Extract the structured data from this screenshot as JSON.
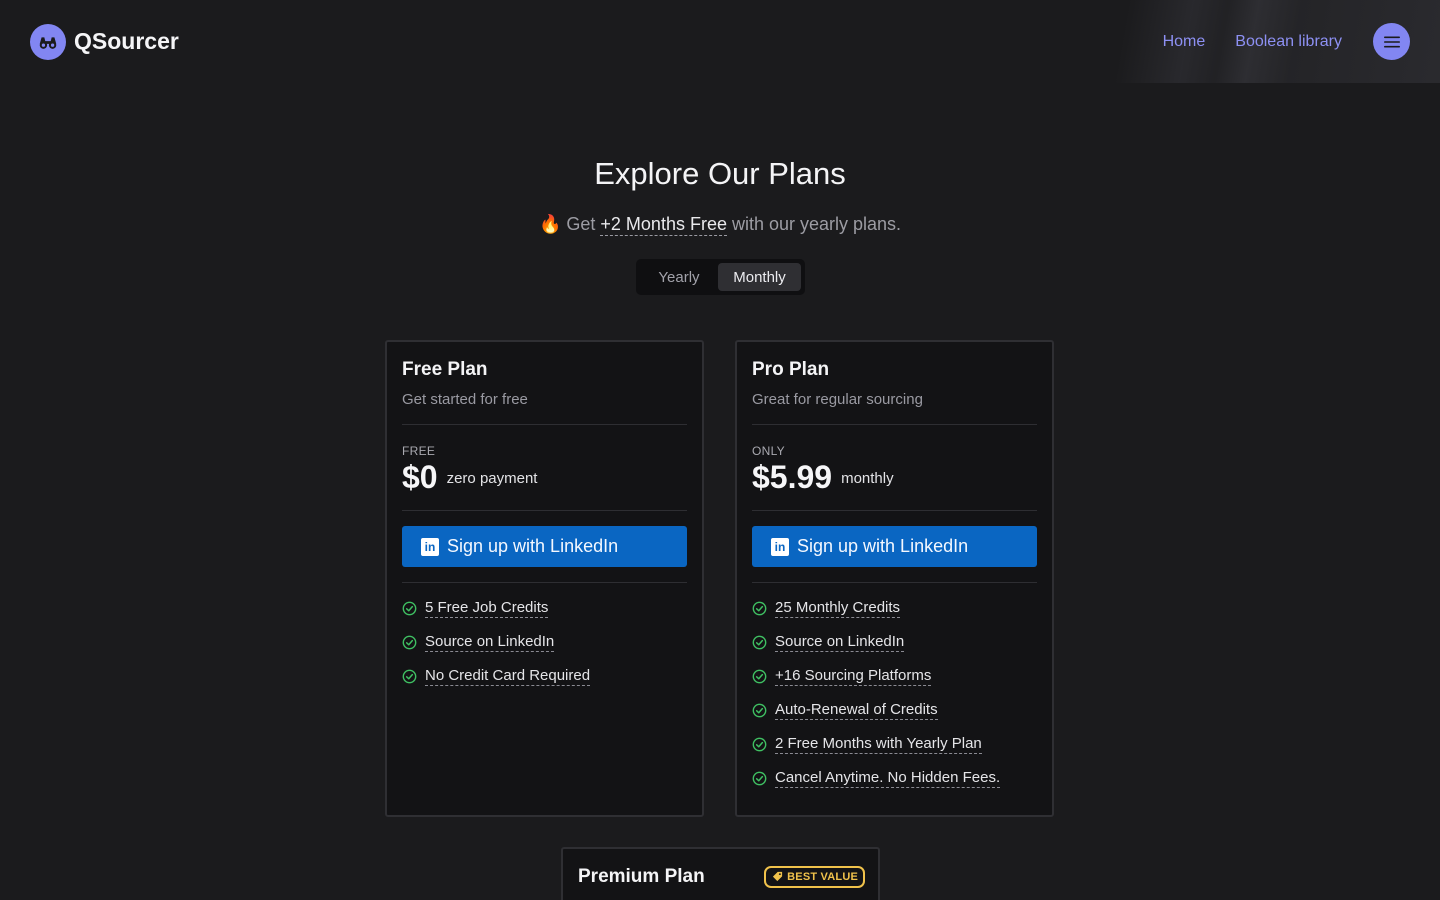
{
  "brand": {
    "name": "QSourcer",
    "logo_icon": "binoculars-icon",
    "accent": "#8286f2"
  },
  "nav": {
    "items": [
      {
        "label": "Home"
      },
      {
        "label": "Boolean library"
      }
    ],
    "menu_icon": "hamburger-menu-icon"
  },
  "hero": {
    "title": "Explore Our Plans",
    "sub_emoji": "🔥",
    "sub_prefix": "Get",
    "sub_highlight": "+2 Months Free",
    "sub_suffix": "with our yearly plans."
  },
  "billing_toggle": {
    "options": [
      {
        "label": "Yearly",
        "selected": false
      },
      {
        "label": "Monthly",
        "selected": true
      }
    ]
  },
  "plans": [
    {
      "name": "Free Plan",
      "description": "Get started for free",
      "price_label": "FREE",
      "price": "$0",
      "price_note": "zero payment",
      "cta_label": "Sign up with LinkedIn",
      "cta_color": "#0a66c2",
      "features": [
        "5 Free Job Credits",
        "Source on LinkedIn",
        "No Credit Card Required"
      ]
    },
    {
      "name": "Pro Plan",
      "description": "Great for regular sourcing",
      "price_label": "ONLY",
      "price": "$5.99",
      "price_note": "monthly",
      "cta_label": "Sign up with LinkedIn",
      "cta_color": "#0a66c2",
      "features": [
        "25 Monthly Credits",
        "Source on LinkedIn",
        "+16 Sourcing Platforms",
        "Auto-Renewal of Credits",
        "2 Free Months with Yearly Plan",
        "Cancel Anytime. No Hidden Fees."
      ]
    },
    {
      "name": "Premium Plan",
      "badge": "BEST VALUE",
      "badge_color": "#f0c24b"
    }
  ],
  "check_color": "#3fbf62"
}
